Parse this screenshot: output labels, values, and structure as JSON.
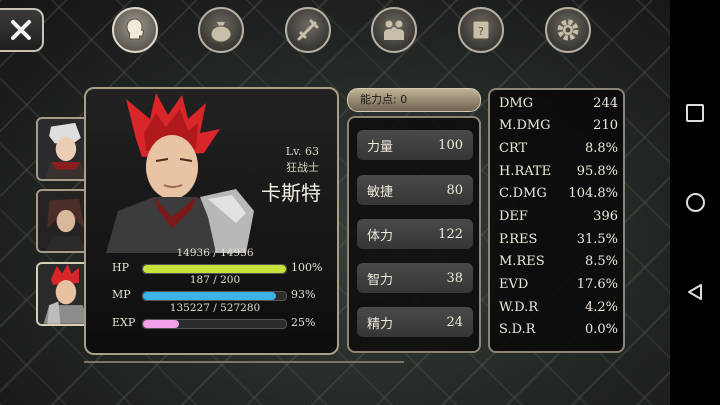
{
  "tabs": [
    {
      "name": "character",
      "icon": "head-icon",
      "active": true
    },
    {
      "name": "inventory",
      "icon": "bag-icon",
      "active": false
    },
    {
      "name": "skills",
      "icon": "sword-icon",
      "active": false
    },
    {
      "name": "party",
      "icon": "people-icon",
      "active": false
    },
    {
      "name": "quest",
      "icon": "scroll-icon",
      "active": false
    },
    {
      "name": "settings",
      "icon": "gear-icon",
      "active": false
    }
  ],
  "character": {
    "level": "Lv. 63",
    "class": "狂战士",
    "name": "卡斯特",
    "hp": {
      "label": "HP",
      "value": "14936 / 14936",
      "pct": "100%",
      "fill": 1.0
    },
    "mp": {
      "label": "MP",
      "value": "187 / 200",
      "pct": "93%",
      "fill": 0.93
    },
    "exp": {
      "label": "EXP",
      "value": "135227 / 527280",
      "pct": "25%",
      "fill": 0.25
    }
  },
  "ability_points": "能力点: 0",
  "attributes": [
    {
      "label": "力量",
      "value": "100"
    },
    {
      "label": "敏捷",
      "value": "80"
    },
    {
      "label": "体力",
      "value": "122"
    },
    {
      "label": "智力",
      "value": "38"
    },
    {
      "label": "精力",
      "value": "24"
    }
  ],
  "stats": [
    {
      "label": "DMG",
      "value": "244"
    },
    {
      "label": "M.DMG",
      "value": "210"
    },
    {
      "label": "CRT",
      "value": "8.8%"
    },
    {
      "label": "H.RATE",
      "value": "95.8%"
    },
    {
      "label": "C.DMG",
      "value": "104.8%"
    },
    {
      "label": "DEF",
      "value": "396"
    },
    {
      "label": "P.RES",
      "value": "31.5%"
    },
    {
      "label": "M.RES",
      "value": "8.5%"
    },
    {
      "label": "EVD",
      "value": "17.6%"
    },
    {
      "label": "W.D.R",
      "value": "4.2%"
    },
    {
      "label": "S.D.R",
      "value": "0.0%"
    }
  ],
  "colors": {
    "hp": "#c6e23a",
    "mp": "#3cb4e6",
    "exp": "#f2a0e8",
    "hair": "#d8262a"
  }
}
